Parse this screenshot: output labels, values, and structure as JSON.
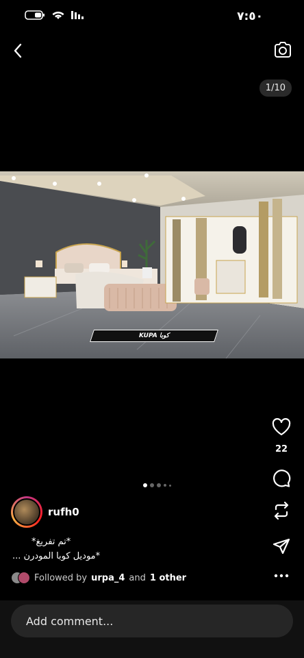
{
  "status": {
    "time": "٧:٥٠"
  },
  "post": {
    "page_counter": "1/10",
    "photo_caption": "KUPA كوبا",
    "likes": "22",
    "username": "rufh0",
    "caption_line1": "*تم تفريغ*",
    "caption_line2": "*موديل  كوبا  المودرن ...",
    "followed": {
      "prefix": "Followed by",
      "user": "urpa_4",
      "and": "and",
      "other": "1 other"
    }
  },
  "comment": {
    "placeholder": "Add comment..."
  },
  "carousel": {
    "total_dots": 5,
    "active_index": 0
  }
}
